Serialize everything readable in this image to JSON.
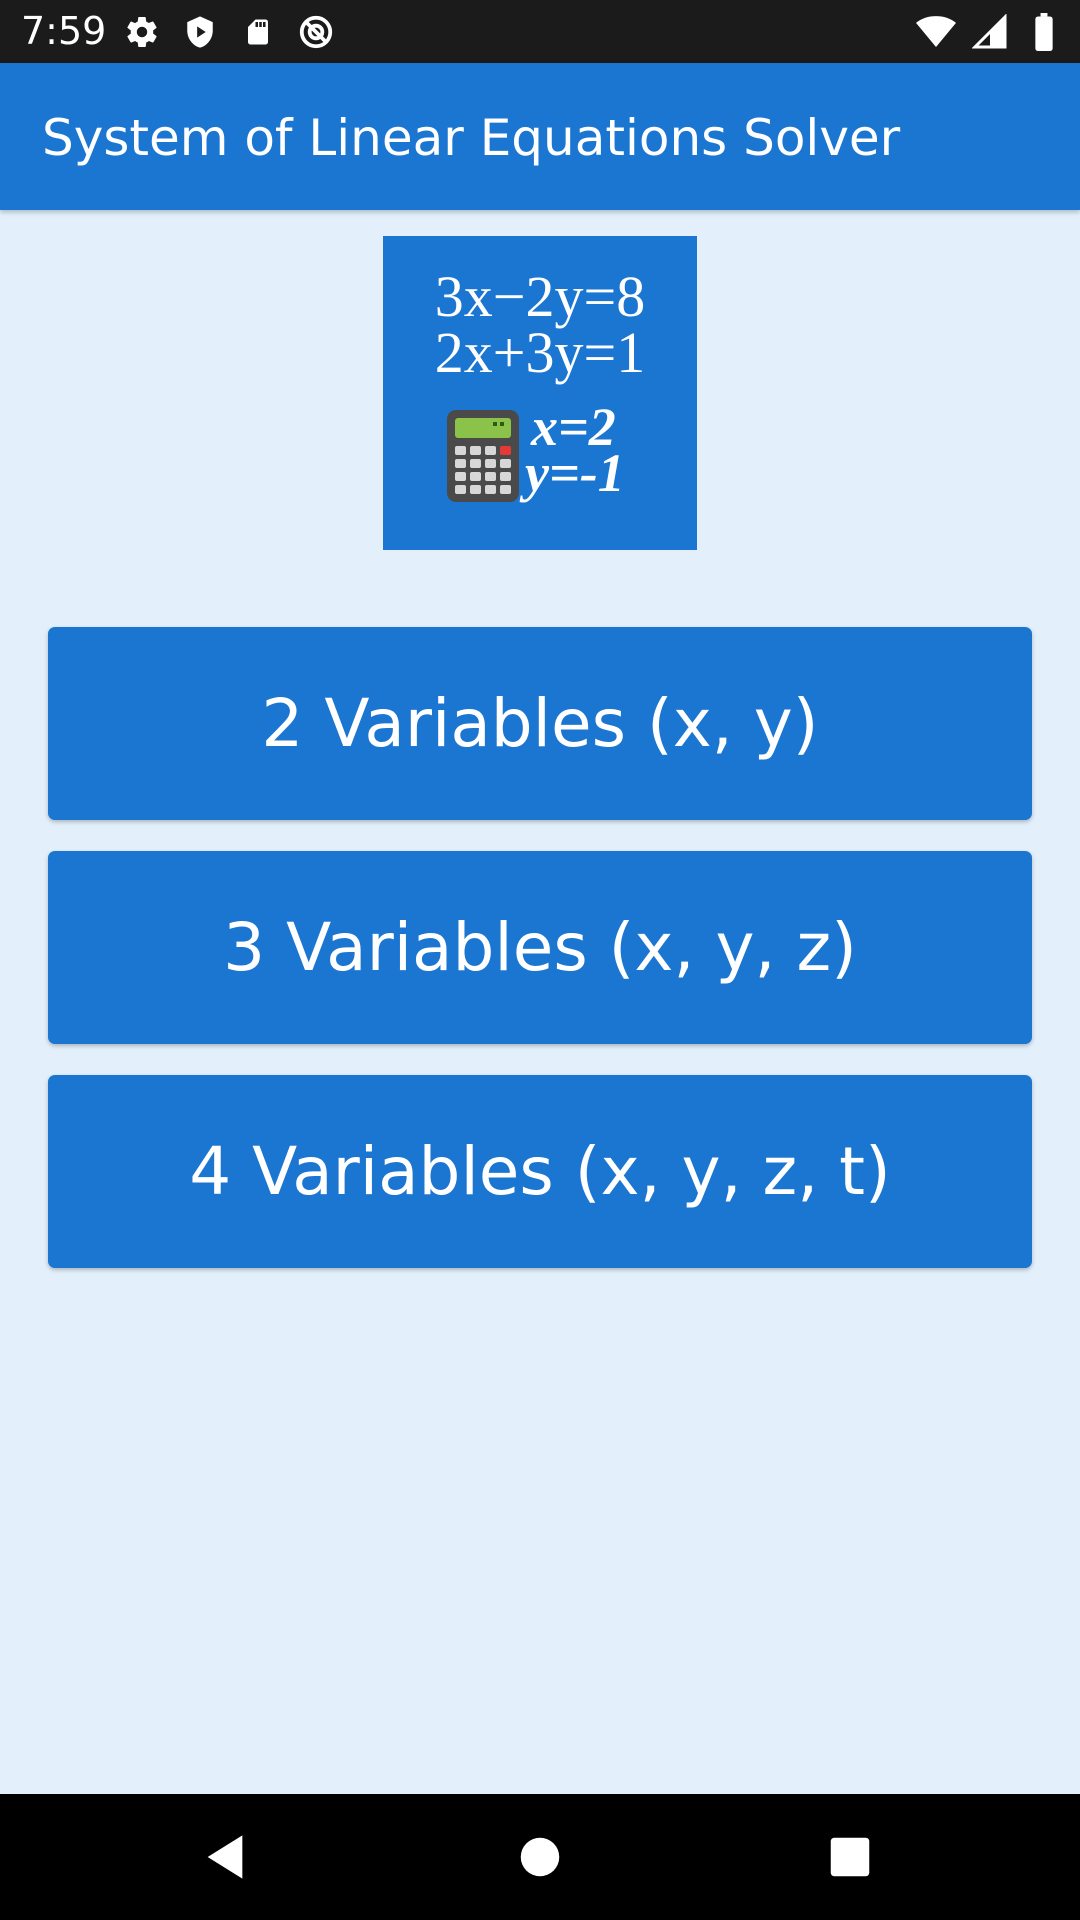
{
  "status_bar": {
    "time": "7:59",
    "left_icons": [
      "gear-icon",
      "shield-play-icon",
      "sd-card-icon",
      "at-sign-icon"
    ],
    "right_icons": [
      "wifi-icon",
      "signal-icon",
      "battery-icon"
    ]
  },
  "app_bar": {
    "title": "System of Linear Equations Solver",
    "color": "#1b76d2"
  },
  "hero": {
    "equation_1": "3x−2y=8",
    "equation_2": "2x+3y=1",
    "solution_1": "x=2",
    "solution_2": "y=-1",
    "icon": "calculator-icon"
  },
  "buttons": [
    {
      "label": "2 Variables (x, y)"
    },
    {
      "label": "3 Variables (x, y, z)"
    },
    {
      "label": "4 Variables (x, y, z, t)"
    }
  ],
  "nav_bar": {
    "icons": [
      "back-icon",
      "home-icon",
      "recents-icon"
    ]
  },
  "colors": {
    "primary": "#1b76d2",
    "background": "#e3f0fc",
    "status_bar": "#1b1b1b",
    "nav_bar": "#000000"
  }
}
